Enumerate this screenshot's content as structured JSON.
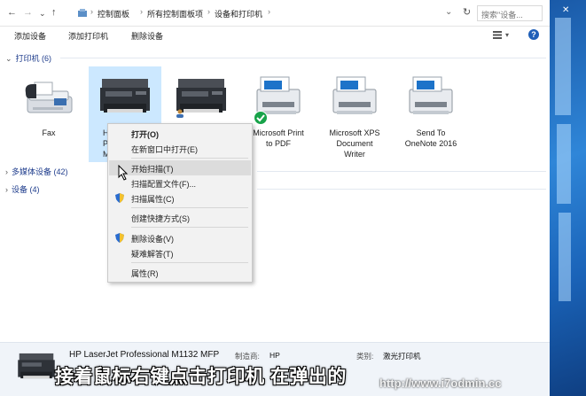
{
  "window": {
    "nav": {
      "back": "←",
      "forward": "→",
      "dropdown": "⌄",
      "up": "↑"
    },
    "breadcrumb": [
      "控制面板",
      "所有控制面板项",
      "设备和打印机"
    ],
    "refresh": "↻",
    "search_placeholder": "搜索\"设备...",
    "close": "✕"
  },
  "toolbar": {
    "add_device": "添加设备",
    "add_printer": "添加打印机",
    "remove_device": "删除设备",
    "help": "?"
  },
  "groups": {
    "printers": "打印机 (6)",
    "multimedia": "多媒体设备 (42)",
    "devices": "设备 (4)"
  },
  "devices": [
    {
      "label": "Fax"
    },
    {
      "label": "H\nPr\nM"
    },
    {
      "label": ""
    },
    {
      "label": "Microsoft Print\nto PDF"
    },
    {
      "label": "Microsoft XPS\nDocument\nWriter"
    },
    {
      "label": "Send To\nOneNote 2016"
    }
  ],
  "context_menu": [
    {
      "label": "打开(O)",
      "bold": true
    },
    {
      "label": "在新窗口中打开(E)"
    },
    {
      "label": "开始扫描(T)",
      "highlight": true
    },
    {
      "label": "扫描配置文件(F)..."
    },
    {
      "label": "扫描属性(C)",
      "shield": true
    },
    {
      "label": "创建快捷方式(S)"
    },
    {
      "label": "删除设备(V)",
      "shield": true
    },
    {
      "label": "疑难解答(T)"
    },
    {
      "label": "属性(R)"
    }
  ],
  "details": {
    "name": "HP LaserJet Professional M1132 MFP",
    "manufacturer_label": "制造商:",
    "manufacturer_value": "HP",
    "category_label": "类别:",
    "category_value": "激光打印机"
  },
  "caption": "接着鼠标右键点击打印机 在弹出的",
  "watermark": "http://www.i7odmin.cc",
  "colors": {
    "selection": "#cce8ff",
    "link_blue": "#1e3c8c",
    "status_green": "#18a34a",
    "desktop_blue": "#1d6fbf"
  }
}
